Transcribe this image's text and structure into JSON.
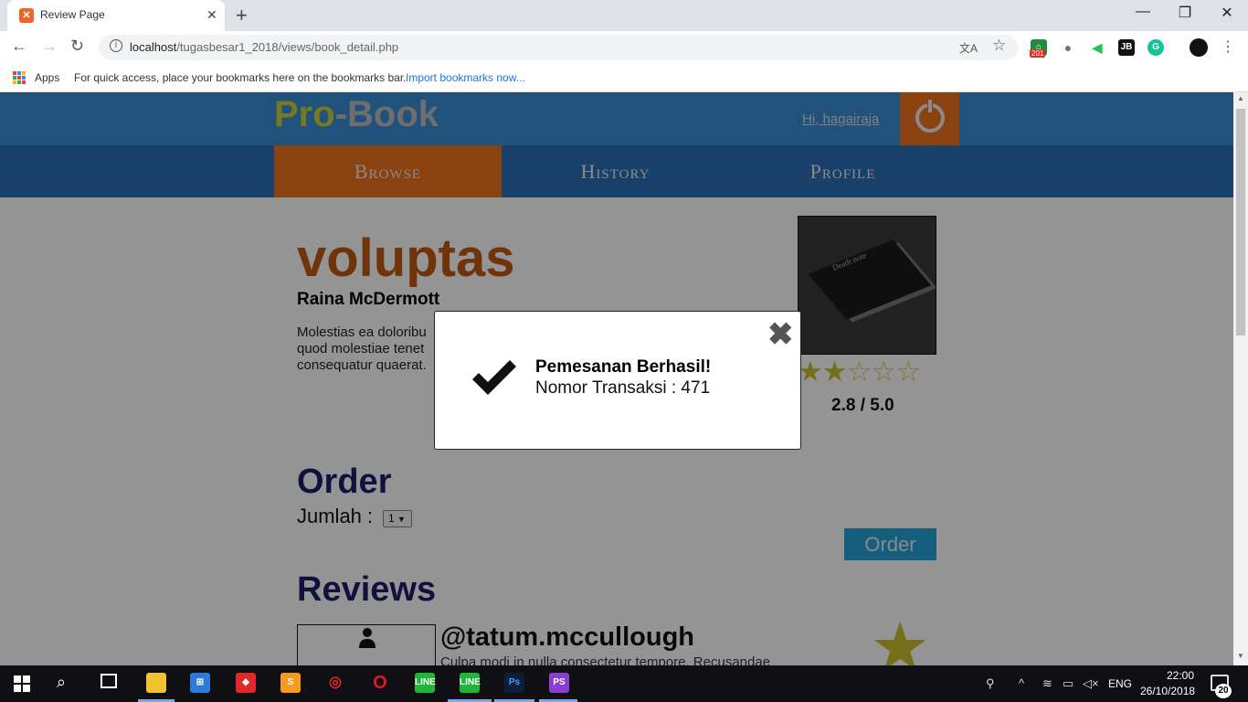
{
  "browser": {
    "tab_title": "Review Page",
    "tab_favicon": "xampp-icon",
    "url_host": "localhost",
    "url_path": "/tugasbesar1_2018/views/book_detail.php",
    "extension_badge": "201",
    "bookmarks": {
      "apps_label": "Apps",
      "hint": "For quick access, place your bookmarks here on the bookmarks bar.",
      "import_link": "Import bookmarks now..."
    }
  },
  "site": {
    "logo_pro": "Pro",
    "logo_book": "-Book",
    "greeting": "Hi, hagairaja",
    "nav": [
      "Browse",
      "History",
      "Profile"
    ],
    "active_nav": "Browse",
    "colors": {
      "header": "#3a8ed4",
      "nav": "#2a6fb8",
      "accent": "#f0731e",
      "title": "#c05a10"
    }
  },
  "book": {
    "title": "voluptas",
    "author": "Raina McDermott",
    "description_lines": [
      "Molestias ea doloribu",
      "quod molestiae tenet",
      "consequatur quaerat."
    ],
    "cover_text": "Death note",
    "rating_stars_filled": 2,
    "rating_stars_total": 5,
    "rating": "2.8 / 5.0"
  },
  "order": {
    "heading": "Order",
    "quantity_label": "Jumlah :",
    "quantity_value": "1",
    "order_button": "Order"
  },
  "reviews": {
    "heading": "Reviews",
    "items": [
      {
        "username": "@tatum.mccullough",
        "text": "Culpa modi in nulla consectetur tempore. Recusandae"
      }
    ]
  },
  "modal": {
    "title": "Pemesanan Berhasil!",
    "message": "Nomor Transaksi : 471",
    "close_glyph": "✖"
  },
  "taskbar": {
    "language": "ENG",
    "time": "22:00",
    "date": "26/10/2018",
    "notification_count": "20"
  }
}
